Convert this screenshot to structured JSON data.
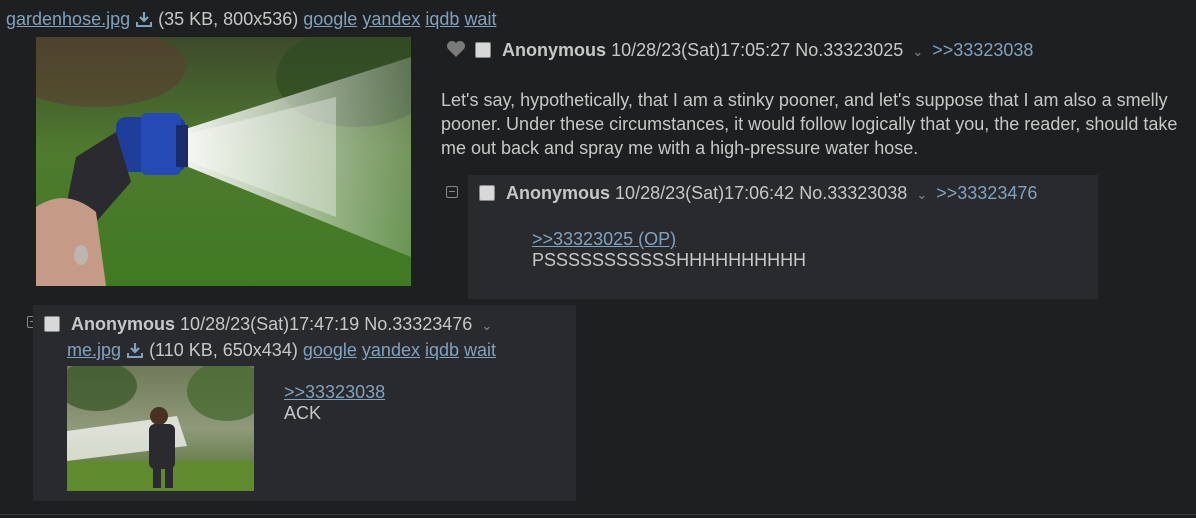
{
  "op": {
    "file": {
      "name": "gardenhose.jpg",
      "meta": "(35 KB, 800x536)"
    },
    "search": [
      "google",
      "yandex",
      "iqdb",
      "wait"
    ],
    "author": "Anonymous",
    "datetime": "10/28/23(Sat)17:05:27",
    "no": "No.33323025",
    "backlink": ">>33323038",
    "body": "Let's say, hypothetically, that I am a stinky pooner, and let's suppose that I am also a smelly pooner. Under these circumstances, it would follow logically that you, the reader, should take me out back and spray me with a high-pressure water hose."
  },
  "reply1": {
    "author": "Anonymous",
    "datetime": "10/28/23(Sat)17:06:42",
    "no": "No.33323038",
    "backlink": ">>33323476",
    "quotelink": ">>33323025 (OP)",
    "body": "PSSSSSSSSSSSHHHHHHHHHH"
  },
  "reply2": {
    "author": "Anonymous",
    "datetime": "10/28/23(Sat)17:47:19",
    "no": "No.33323476",
    "file": {
      "name": "me.jpg",
      "meta": "(110 KB, 650x434)"
    },
    "search": [
      "google",
      "yandex",
      "iqdb",
      "wait"
    ],
    "quotelink": ">>33323038",
    "body": "ACK"
  }
}
